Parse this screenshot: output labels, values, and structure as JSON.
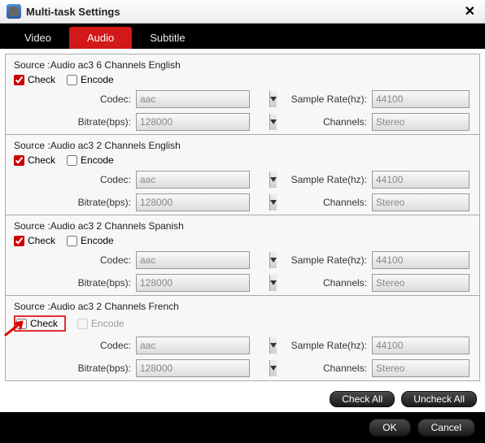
{
  "window": {
    "title": "Multi-task Settings"
  },
  "tabs": {
    "video": "Video",
    "audio": "Audio",
    "subtitle": "Subtitle"
  },
  "labels": {
    "check": "Check",
    "encode": "Encode",
    "codec": "Codec:",
    "bitrate": "Bitrate(bps):",
    "samplerate": "Sample Rate(hz):",
    "channels": "Channels:"
  },
  "groups": [
    {
      "source": "Source :Audio  ac3  6 Channels  English",
      "check": true,
      "encode": false,
      "encode_disabled": false,
      "codec": "aac",
      "bitrate": "128000",
      "samplerate": "44100",
      "channels": "Stereo",
      "highlight": false
    },
    {
      "source": "Source :Audio  ac3  2 Channels  English",
      "check": true,
      "encode": false,
      "encode_disabled": false,
      "codec": "aac",
      "bitrate": "128000",
      "samplerate": "44100",
      "channels": "Stereo",
      "highlight": false
    },
    {
      "source": "Source :Audio  ac3  2 Channels  Spanish",
      "check": true,
      "encode": false,
      "encode_disabled": false,
      "codec": "aac",
      "bitrate": "128000",
      "samplerate": "44100",
      "channels": "Stereo",
      "highlight": false
    },
    {
      "source": "Source :Audio  ac3  2 Channels  French",
      "check": false,
      "encode": false,
      "encode_disabled": true,
      "codec": "aac",
      "bitrate": "128000",
      "samplerate": "44100",
      "channels": "Stereo",
      "highlight": true
    }
  ],
  "buttons": {
    "check_all": "Check All",
    "uncheck_all": "Uncheck All",
    "ok": "OK",
    "cancel": "Cancel"
  }
}
